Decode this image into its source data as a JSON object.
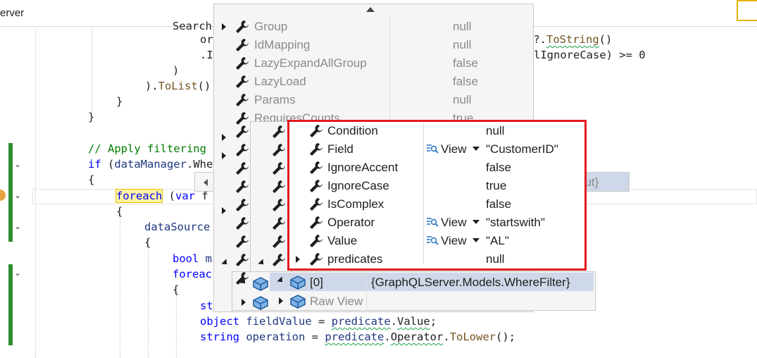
{
  "editor": {
    "tab_label": "erver",
    "lines": [
      {
        "indent": 0,
        "html_id": "l1"
      },
      {
        "text_a": "or",
        "text_b": "der)?.",
        "text_c": "ToString",
        "text_d": "()"
      },
      {
        "text_a": ".I",
        "text_b": "inalIgnoreCase) >= 0"
      },
      {
        "text": ")"
      },
      {
        "text_a": ").",
        "text_b": "ToList",
        "text_c": "()"
      },
      {
        "text": "}"
      },
      {
        "text": "}"
      },
      {
        "comment": "// Apply filtering"
      },
      {
        "kw": "if",
        "rest_a": " (",
        "var": "dataManager",
        "rest_b": ".Whe"
      },
      {
        "text": "{"
      },
      {
        "kw": "foreach",
        "rest_a": " (",
        "kw2": "var",
        "rest_b": " f"
      },
      {
        "text": "{"
      },
      {
        "var": "dataSource"
      },
      {
        "text": "{"
      },
      {
        "kw": "bool",
        "rest": " m"
      },
      {
        "kw": "foreac"
      },
      {
        "text": "{"
      },
      {
        "kw": "st"
      },
      {
        "kw": "object",
        "var": "fieldValue",
        "eq": " = ",
        "var2": "predicate",
        "dot": ".",
        "prop": "Value",
        "end": ";"
      },
      {
        "kw": "string",
        "var": "operation",
        "eq": " = ",
        "var2": "predicate",
        "dot": ".",
        "prop": "Operator",
        "dot2": ".",
        "mt": "ToLower",
        "end": "();"
      }
    ]
  },
  "outer_panel": {
    "rows": [
      {
        "name": "Group",
        "value": "null"
      },
      {
        "name": "IdMapping",
        "value": "null"
      },
      {
        "name": "LazyExpandAllGroup",
        "value": "false"
      },
      {
        "name": "LazyLoad",
        "value": "false"
      },
      {
        "name": "Params",
        "value": "null"
      },
      {
        "name": "RequiresCounts",
        "value": "true"
      }
    ],
    "partial_value": "out}"
  },
  "inner_panel": {
    "rows": [
      {
        "name": "Condition",
        "view": "",
        "value": "null"
      },
      {
        "name": "Field",
        "view": "View",
        "value": "\"CustomerID\""
      },
      {
        "name": "IgnoreAccent",
        "view": "",
        "value": "false"
      },
      {
        "name": "IgnoreCase",
        "view": "",
        "value": "true"
      },
      {
        "name": "IsComplex",
        "view": "",
        "value": "false"
      },
      {
        "name": "Operator",
        "view": "View",
        "value": "\"startswith\""
      },
      {
        "name": "Value",
        "view": "View",
        "value": "\"AL\""
      },
      {
        "name": "predicates",
        "view": "",
        "value": "null"
      }
    ]
  },
  "list_panel": {
    "item_name": "[0]",
    "item_value": "{GraphQLServer.Models.WhereFilter}",
    "raw_view": "Raw View"
  },
  "colors": {
    "highlight_box": "#e21b1b",
    "keyword": "#0000ff",
    "comment": "#008000",
    "selection": "#cfd8e8"
  }
}
